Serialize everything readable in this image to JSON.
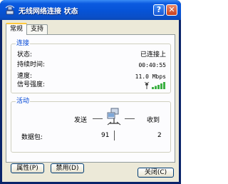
{
  "window": {
    "title": "无线网络连接 状态",
    "help_button": "?",
    "close_button": "✕"
  },
  "tabs": [
    {
      "label": "常规",
      "active": true
    },
    {
      "label": "支持",
      "active": false
    }
  ],
  "connection": {
    "legend": "连接",
    "rows": [
      {
        "label": "状态:",
        "value": "已连接上"
      },
      {
        "label": "持续时间:",
        "value": "00:40:55"
      },
      {
        "label": "速度:",
        "value": "11.0 Mbps"
      },
      {
        "label": "信号强度:",
        "value_icon": "signal-strength-icon",
        "bars_lit": 5,
        "bars_total": 5
      }
    ]
  },
  "activity": {
    "legend": "活动",
    "sent_label": "发送",
    "received_label": "收到",
    "packets_label": "数据包:",
    "sent_value": "91",
    "received_value": "2",
    "icon": "network-activity-icon"
  },
  "buttons": {
    "properties": "属性(P)",
    "disable": "禁用(D)",
    "close": "关闭(C)"
  },
  "colors": {
    "title_bar": "#0653d6",
    "group_legend": "#0046d5",
    "signal_bar": "#3cb043",
    "tab_highlight": "#ffc83c"
  }
}
